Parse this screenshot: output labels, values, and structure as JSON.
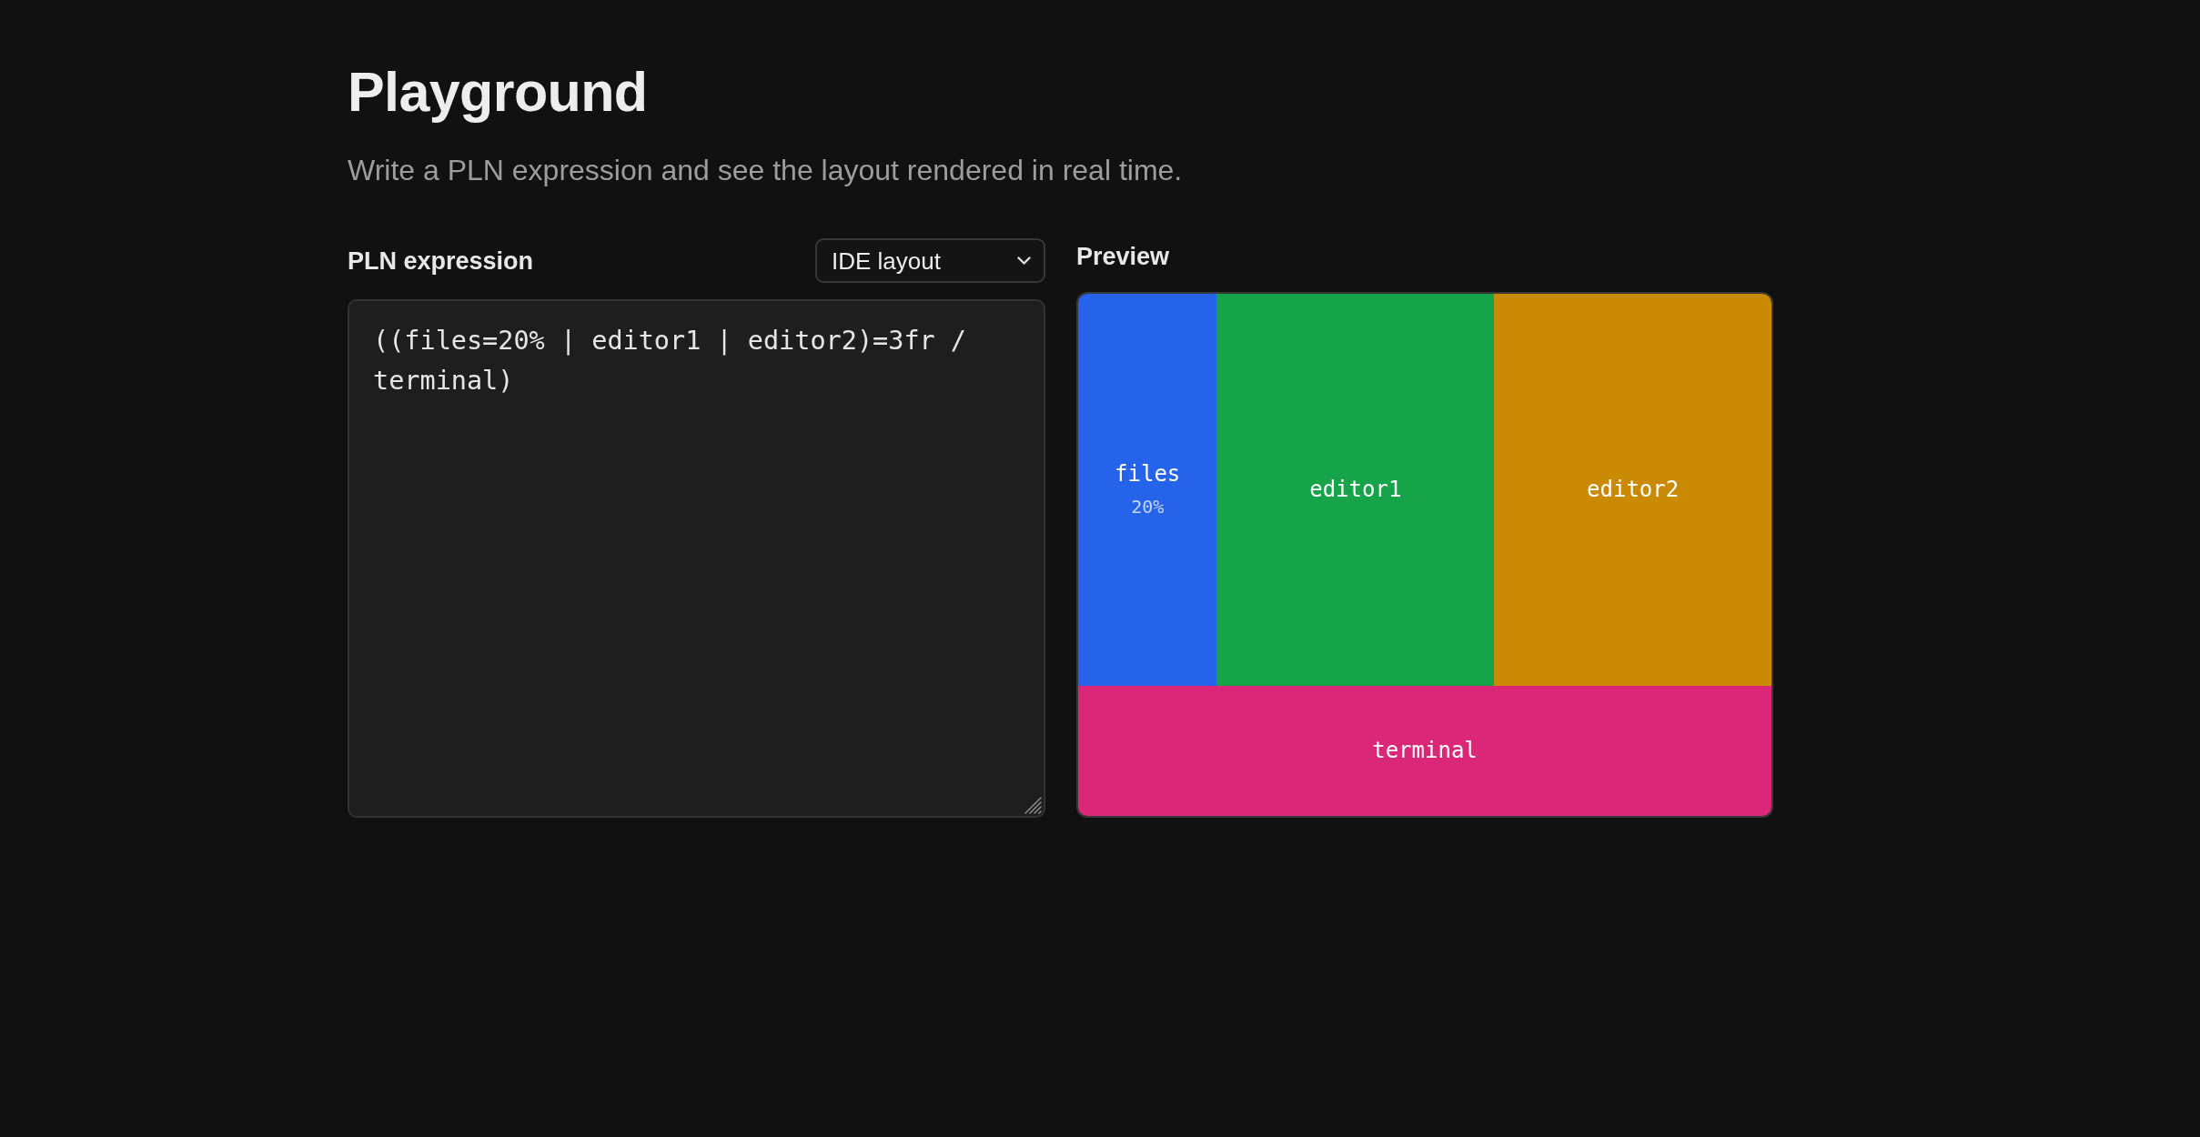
{
  "header": {
    "title": "Playground",
    "subtitle": "Write a PLN expression and see the layout rendered in real time."
  },
  "editor": {
    "label": "PLN expression",
    "preset": {
      "value": "IDE layout"
    },
    "expression": "((files=20% | editor1 | editor2)=3fr / terminal)"
  },
  "preview": {
    "label": "Preview",
    "rows": [
      {
        "panes": [
          {
            "name": "files",
            "size": "20%",
            "color": "#2563eb"
          },
          {
            "name": "editor1",
            "color": "#16a34a"
          },
          {
            "name": "editor2",
            "color": "#ca8a04"
          }
        ]
      },
      {
        "panes": [
          {
            "name": "terminal",
            "color": "#db2777"
          }
        ]
      }
    ]
  }
}
